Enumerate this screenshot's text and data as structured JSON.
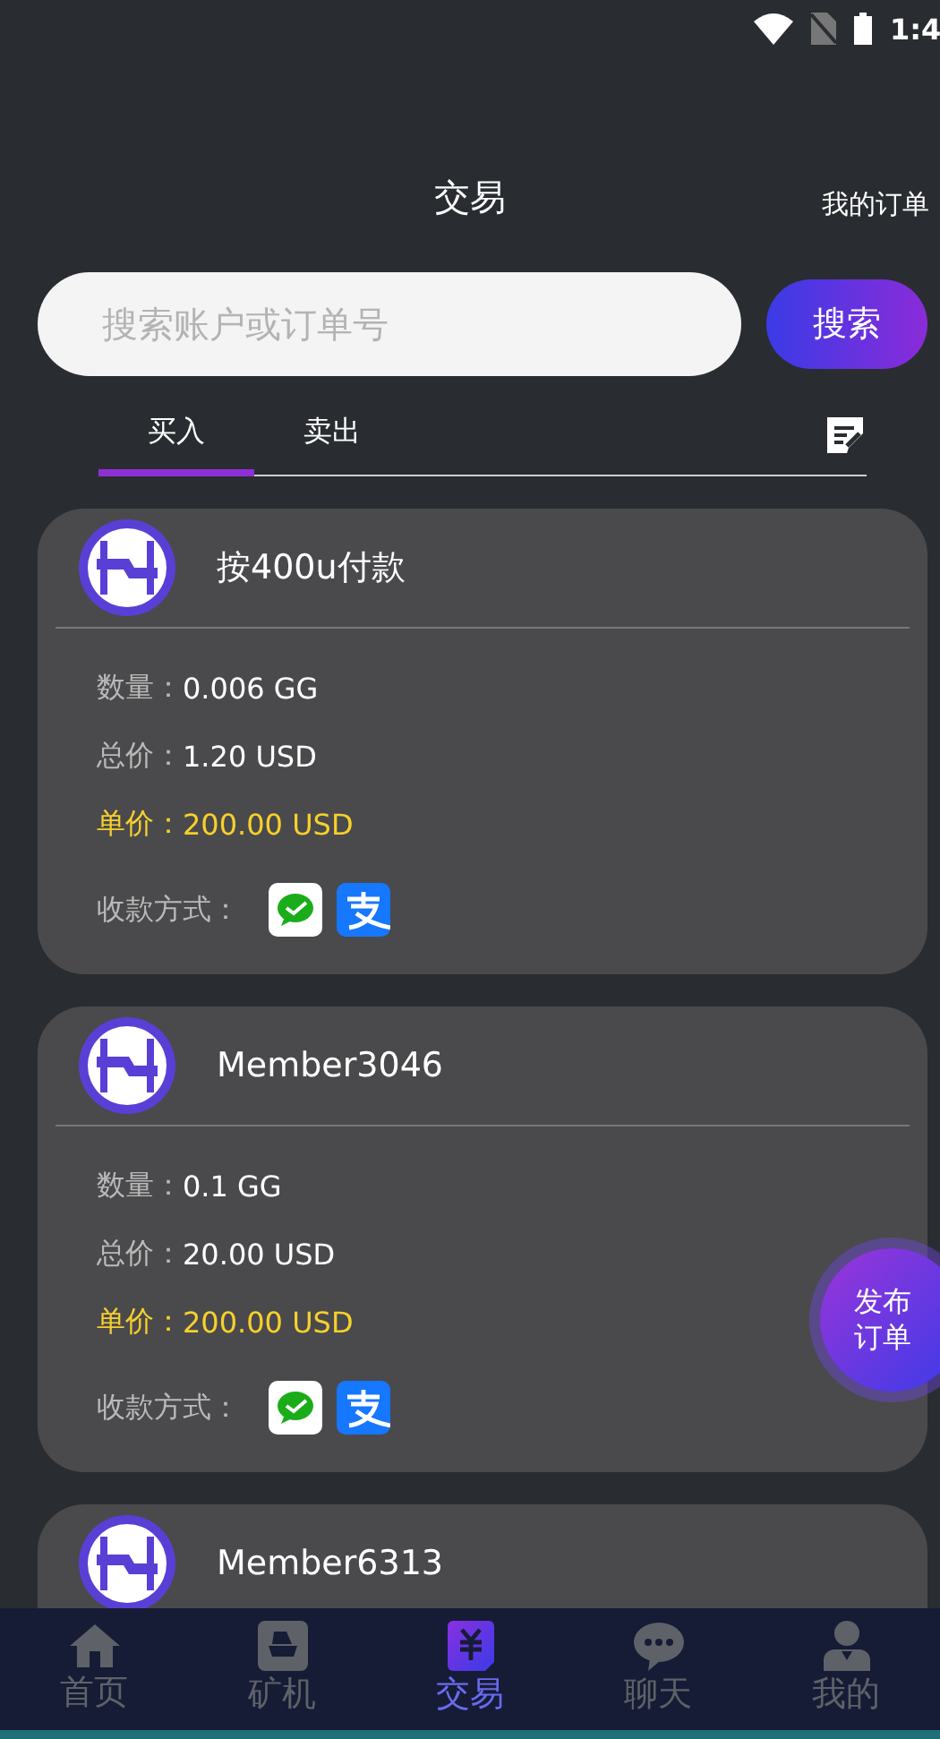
{
  "status_bar": {
    "time": "1:4"
  },
  "header": {
    "title": "交易",
    "action": "我的订单"
  },
  "search": {
    "placeholder": "搜索账户或订单号",
    "button": "搜索"
  },
  "tabs": [
    {
      "label": "买入",
      "selected": true
    },
    {
      "label": "卖出",
      "selected": false
    }
  ],
  "orders": [
    {
      "name": "按400u付款",
      "fields": [
        {
          "label": "数量：",
          "value": "0.006 GG",
          "highlight": false
        },
        {
          "label": "总价：",
          "value": "1.20 USD",
          "highlight": false
        },
        {
          "label": "单价：",
          "value": "200.00 USD",
          "highlight": true
        }
      ],
      "payment_label": "收款方式："
    },
    {
      "name": "Member3046",
      "fields": [
        {
          "label": "数量：",
          "value": "0.1 GG",
          "highlight": false
        },
        {
          "label": "总价：",
          "value": "20.00 USD",
          "highlight": false
        },
        {
          "label": "单价：",
          "value": "200.00 USD",
          "highlight": true
        }
      ],
      "payment_label": "收款方式："
    },
    {
      "name": "Member6313"
    }
  ],
  "fab": {
    "label": "发布订单"
  },
  "nav": [
    {
      "label": "首页",
      "kind": "home",
      "selected": false
    },
    {
      "label": "矿机",
      "kind": "miner",
      "selected": false
    },
    {
      "label": "交易",
      "kind": "trade",
      "selected": true
    },
    {
      "label": "聊天",
      "kind": "chat",
      "selected": false
    },
    {
      "label": "我的",
      "kind": "user",
      "selected": false
    }
  ]
}
